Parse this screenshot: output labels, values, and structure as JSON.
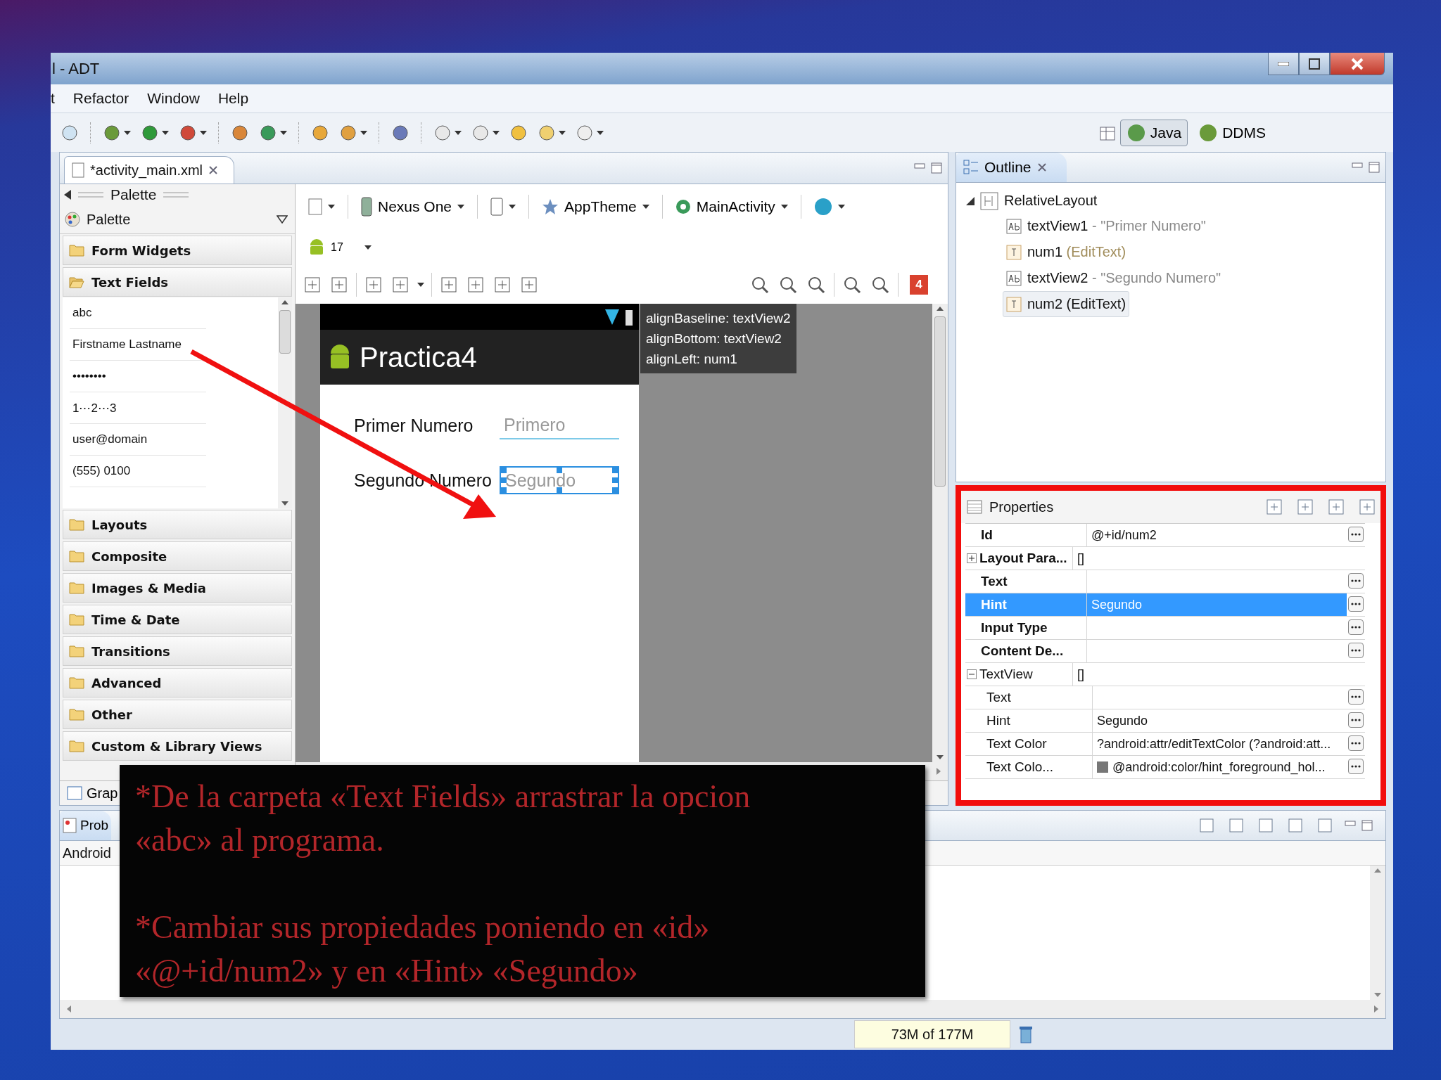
{
  "window": {
    "title": "l - ADT"
  },
  "menu": [
    {
      "label": "t"
    },
    {
      "label": "Refactor"
    },
    {
      "label": "Window"
    },
    {
      "label": "Help"
    }
  ],
  "perspectives": [
    {
      "label": "Java",
      "selected": true
    },
    {
      "label": "DDMS",
      "selected": false
    }
  ],
  "editor": {
    "tab": "*activity_main.xml",
    "bottom_tab": "Grap"
  },
  "palette": {
    "header": "Palette",
    "selector": "Palette",
    "categories": [
      {
        "label": "Form Widgets",
        "expanded": false
      },
      {
        "label": "Text Fields",
        "expanded": true,
        "items": [
          "abc",
          "Firstname Lastname",
          "••••••••",
          "1⋯2⋯3",
          "user@domain",
          "(555) 0100"
        ]
      },
      {
        "label": "Layouts",
        "expanded": false
      },
      {
        "label": "Composite",
        "expanded": false
      },
      {
        "label": "Images & Media",
        "expanded": false
      },
      {
        "label": "Time & Date",
        "expanded": false
      },
      {
        "label": "Transitions",
        "expanded": false
      },
      {
        "label": "Advanced",
        "expanded": false
      },
      {
        "label": "Other",
        "expanded": false
      },
      {
        "label": "Custom & Library Views",
        "expanded": false
      }
    ]
  },
  "layout_editor": {
    "device": "Nexus One",
    "theme": "AppTheme",
    "activity": "MainActivity",
    "api_level": "17",
    "error_count": "4",
    "preview": {
      "app_title": "Practica4",
      "rows": [
        {
          "label": "Primer Numero",
          "hint": "Primero",
          "selected": false
        },
        {
          "label": "Segundo Numero",
          "hint": "Segundo",
          "selected": true
        }
      ]
    },
    "tooltip": [
      "alignBaseline: textView2",
      "alignBottom: textView2",
      "alignLeft: num1"
    ]
  },
  "outline": {
    "title": "Outline",
    "root": {
      "name": "RelativeLayout",
      "expanded": true,
      "children": [
        {
          "name": "textView1",
          "detail": "- \"Primer Numero\"",
          "kind": "textview",
          "selected": false
        },
        {
          "name": "num1",
          "detail": "(EditText)",
          "kind": "edittext",
          "selected": false
        },
        {
          "name": "textView2",
          "detail": "- \"Segundo Numero\"",
          "kind": "textview",
          "selected": false
        },
        {
          "name": "num2",
          "detail": "(EditText)",
          "kind": "edittext",
          "selected": true
        }
      ]
    }
  },
  "properties": {
    "title": "Properties",
    "rows": [
      {
        "name": "Id",
        "value": "@+id/num2",
        "bold": true,
        "selected": false,
        "has_button": true
      },
      {
        "name": "Layout Para...",
        "value": "[]",
        "bold": true,
        "selected": false,
        "has_button": false,
        "expanded": false
      },
      {
        "name": "Text",
        "bold": true,
        "selected": false,
        "has_button": true
      },
      {
        "name": "Hint",
        "value": "Segundo",
        "bold": true,
        "selected": true,
        "has_button": true
      },
      {
        "name": "Input Type",
        "bold": true,
        "selected": false,
        "has_button": true
      },
      {
        "name": "Content De...",
        "bold": true,
        "selected": false,
        "has_button": true
      },
      {
        "name": "TextView",
        "value": "[]",
        "bold": false,
        "selected": false,
        "has_button": false,
        "expanded": true,
        "children": [
          {
            "name": "Text",
            "bold": false,
            "selected": false,
            "has_button": true
          },
          {
            "name": "Hint",
            "value": "Segundo",
            "bold": false,
            "selected": false,
            "has_button": true
          },
          {
            "name": "Text Color",
            "value": "?android:attr/editTextColor (?android:att...",
            "bold": false,
            "selected": false,
            "has_button": true
          },
          {
            "name": "Text Colo...",
            "value": "@android:color/hint_foreground_hol...",
            "bold": false,
            "selected": false,
            "has_button": true,
            "swatch": true
          }
        ]
      }
    ]
  },
  "problems": {
    "tab": "Prob",
    "section": "Android"
  },
  "status_bar": {
    "memory": "73M of 177M"
  },
  "annotation": {
    "paragraphs": [
      "*De la carpeta «Text Fields» arrastrar la opcion «abc» al programa.",
      "*Cambiar sus propiedades poniendo en «id» «@+id/num2» y en «Hint» «Segundo»"
    ]
  }
}
